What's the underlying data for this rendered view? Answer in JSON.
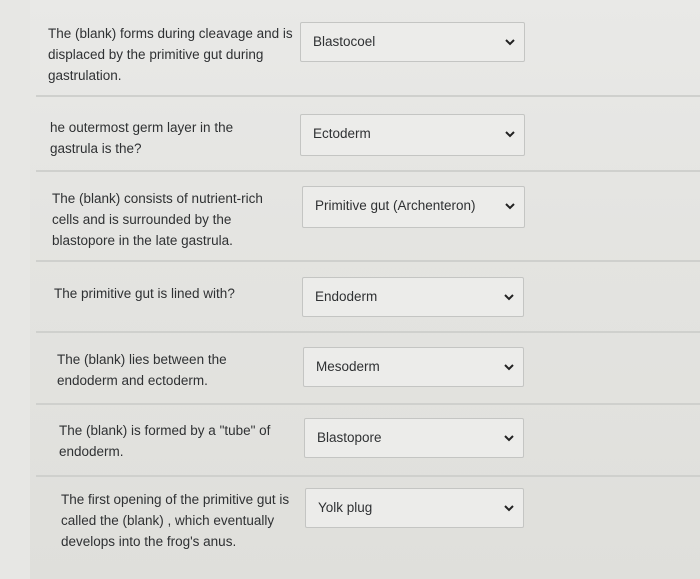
{
  "questions": [
    {
      "prompt": "The (blank) forms during cleavage and is displaced by the primitive gut during gastrulation.",
      "answer": "Blastocoel"
    },
    {
      "prompt": "he outermost germ layer in the gastrula is the?",
      "answer": "Ectoderm"
    },
    {
      "prompt": "The (blank) consists of nutrient-rich cells and is surrounded by the blastopore in the late gastrula.",
      "answer": "Primitive gut (Archenteron)"
    },
    {
      "prompt": "The primitive gut is lined with?",
      "answer": "Endoderm"
    },
    {
      "prompt": "The (blank) lies between the endoderm and ectoderm.",
      "answer": "Mesoderm"
    },
    {
      "prompt": "The (blank) is formed by a \"tube\" of endoderm.",
      "answer": "Blastopore"
    },
    {
      "prompt": "The first opening of the primitive gut is called the (blank) , which eventually develops into the frog's anus.",
      "answer": "Yolk plug"
    }
  ],
  "icons": {
    "dropdown": "chevron-down-icon"
  }
}
